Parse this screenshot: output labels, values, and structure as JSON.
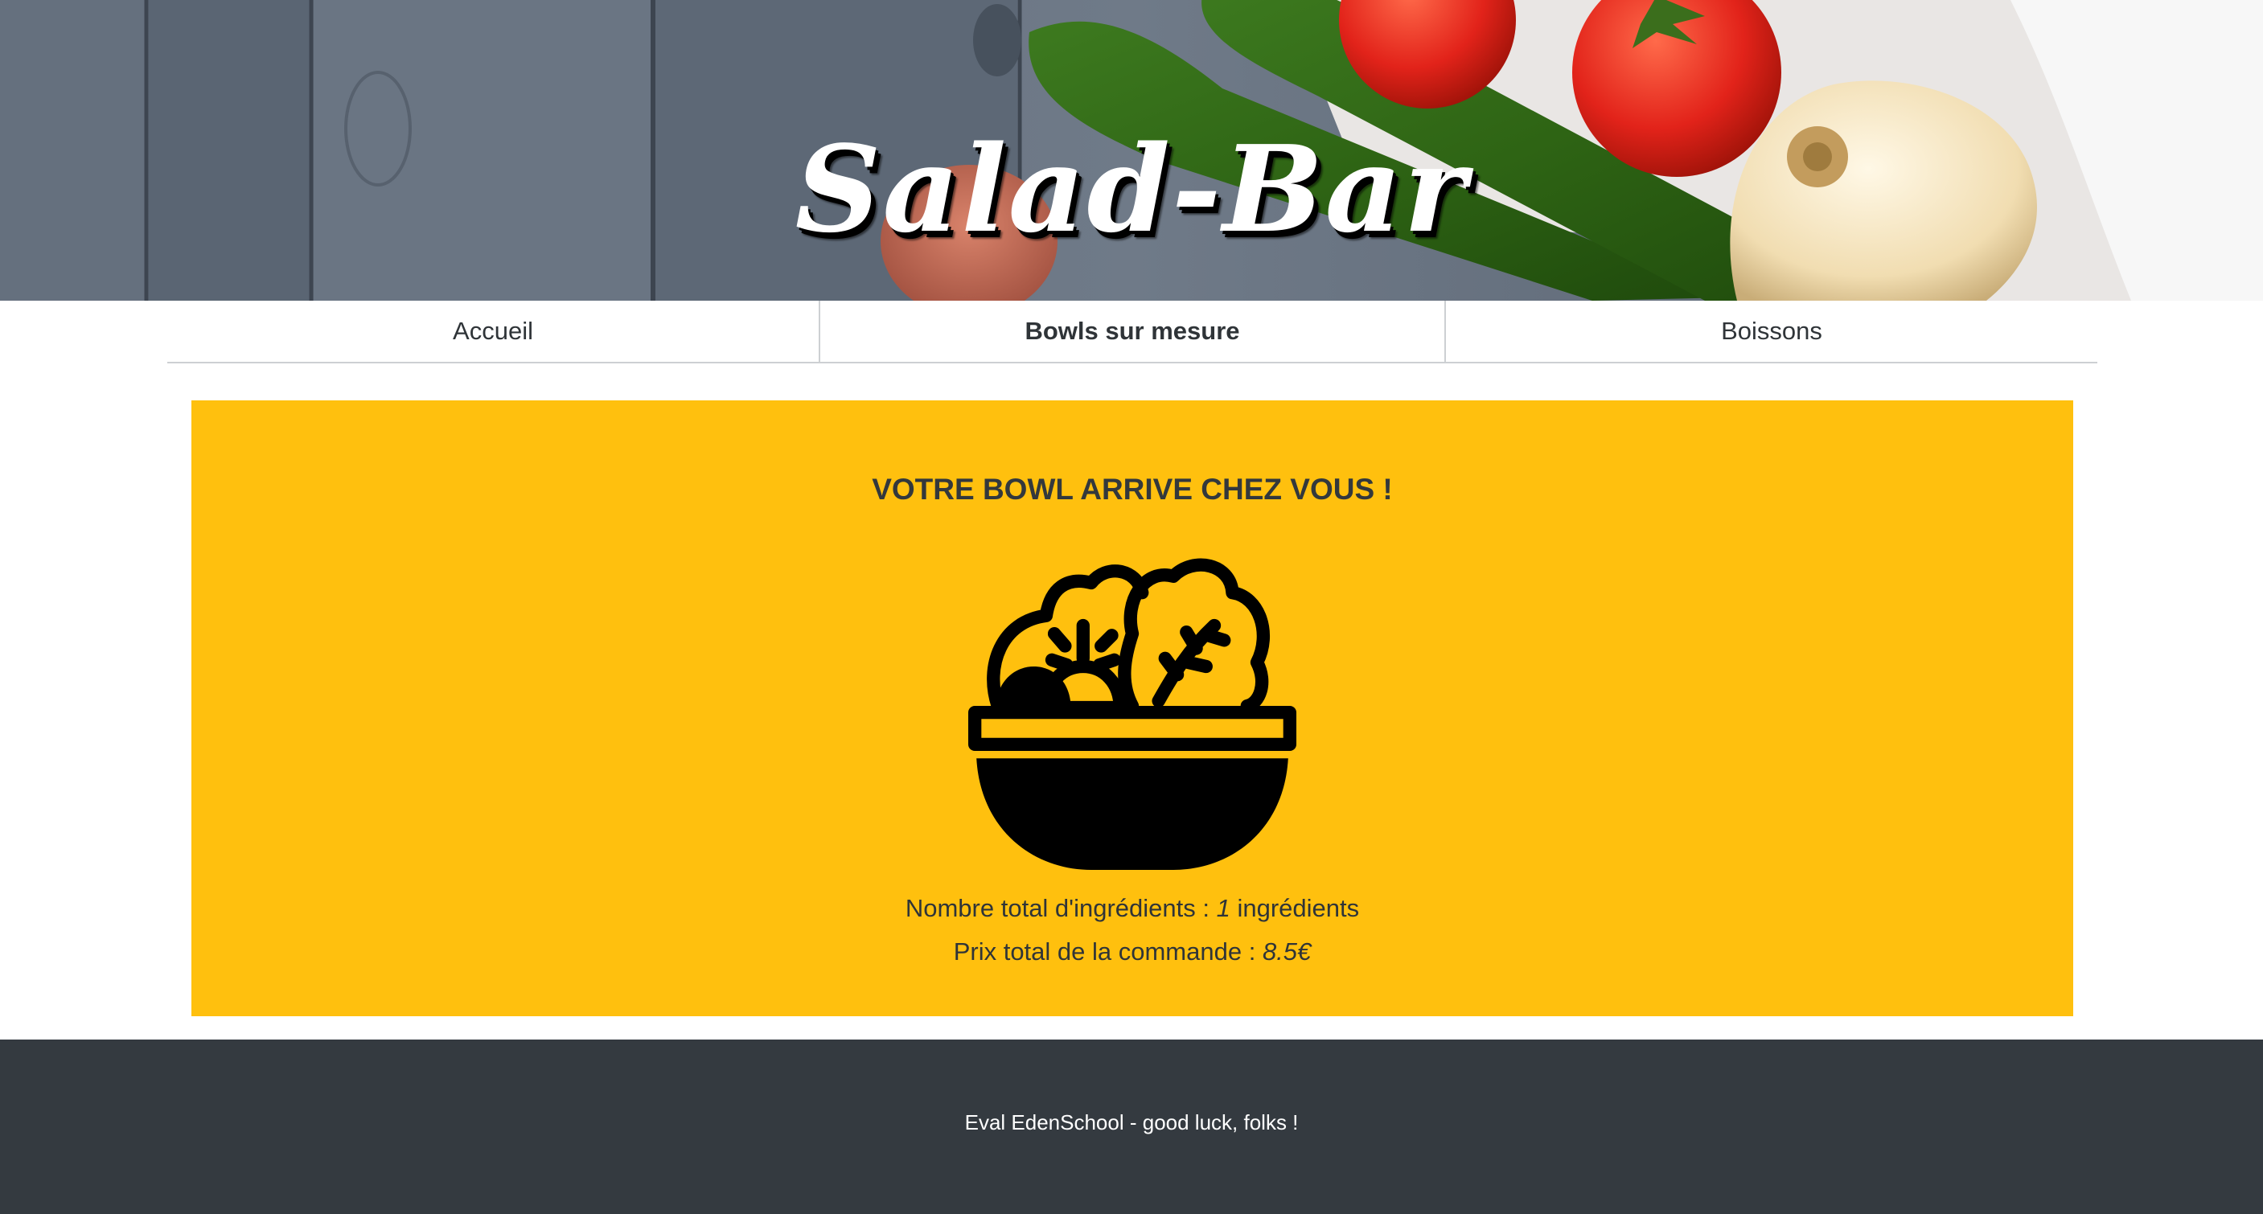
{
  "header": {
    "title": "Salad-Bar"
  },
  "nav": {
    "items": [
      {
        "label": "Accueil",
        "active": false
      },
      {
        "label": "Bowls sur mesure",
        "active": true
      },
      {
        "label": "Boissons",
        "active": false
      }
    ]
  },
  "main": {
    "title": "VOTRE BOWL ARRIVE CHEZ VOUS !",
    "icon": "salad-bowl-icon",
    "ingredients_label": "Nombre total d'ingrédients : ",
    "ingredients_count": "1",
    "ingredients_unit": " ingrédients",
    "price_label": "Prix total de la commande : ",
    "price_value": "8.5€"
  },
  "footer": {
    "text": "Eval EdenSchool - good luck, folks !"
  },
  "colors": {
    "card_background": "#ffc00e",
    "footer_background": "#343a40",
    "text": "#333a40"
  }
}
